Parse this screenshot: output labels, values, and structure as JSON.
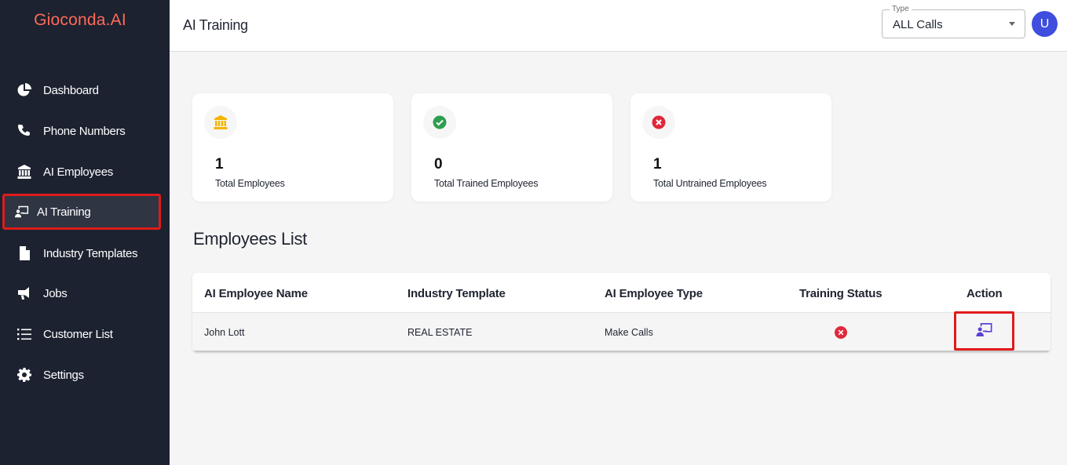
{
  "app": {
    "brand": "Gioconda.AI"
  },
  "sidebar": {
    "items": [
      {
        "label": "Dashboard",
        "icon": "pie-chart-icon"
      },
      {
        "label": "Phone Numbers",
        "icon": "phone-icon"
      },
      {
        "label": "AI Employees",
        "icon": "building-icon"
      },
      {
        "label": "AI Training",
        "icon": "presentation-icon",
        "active": true
      },
      {
        "label": "Industry Templates",
        "icon": "file-icon"
      },
      {
        "label": "Jobs",
        "icon": "megaphone-icon"
      },
      {
        "label": "Customer List",
        "icon": "list-icon"
      },
      {
        "label": "Settings",
        "icon": "gear-icon"
      }
    ]
  },
  "header": {
    "title": "AI Training",
    "type_filter": {
      "legend": "Type",
      "value": "ALL Calls"
    },
    "avatar_initial": "U"
  },
  "stats": [
    {
      "value": "1",
      "label": "Total Employees",
      "icon": "building-icon",
      "color": "#f4b400"
    },
    {
      "value": "0",
      "label": "Total Trained Employees",
      "icon": "check-circle-icon",
      "color": "#2e9e4f"
    },
    {
      "value": "1",
      "label": "Total Untrained Employees",
      "icon": "x-circle-icon",
      "color": "#e0283a"
    }
  ],
  "employees": {
    "title": "Employees List",
    "columns": [
      "AI Employee Name",
      "Industry Template",
      "AI Employee Type",
      "Training Status",
      "Action"
    ],
    "rows": [
      {
        "name": "John Lott",
        "template": "REAL ESTATE",
        "type": "Make Calls",
        "training_status": "untrained",
        "action": "train"
      }
    ]
  },
  "colors": {
    "accent": "#3f4ede",
    "sidebar": "#1c2230",
    "brand": "#ff6b57",
    "action_icon": "#5b3fd6"
  }
}
